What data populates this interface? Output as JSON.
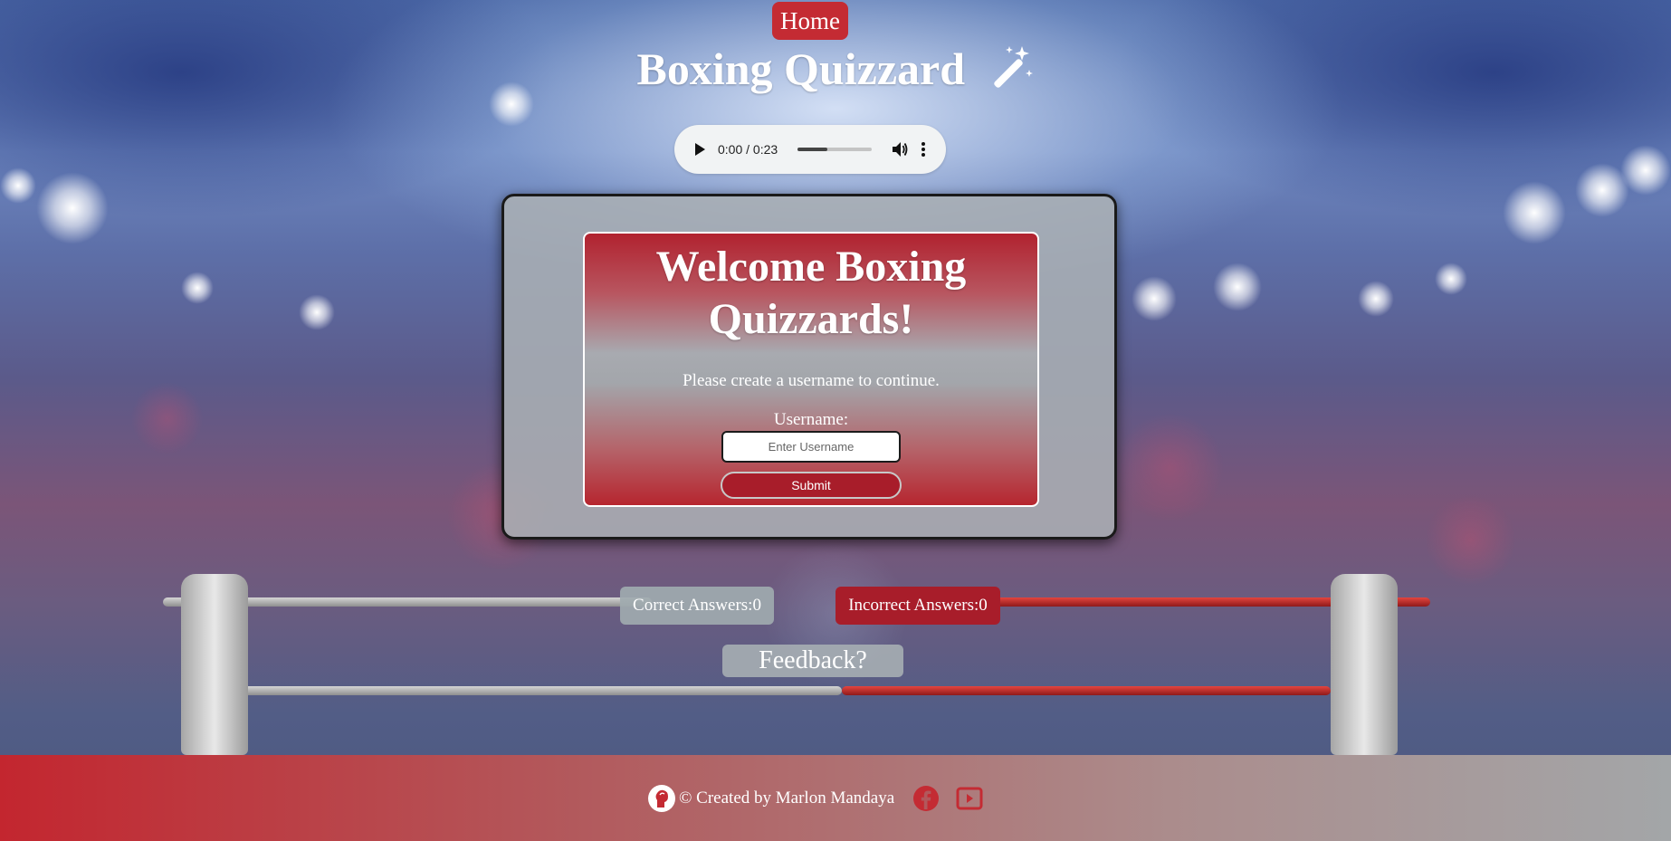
{
  "nav": {
    "home_label": "Home"
  },
  "header": {
    "title": "Boxing Quizzard",
    "title_icon": "magic-wand-icon"
  },
  "audio": {
    "time": "0:00 / 0:23",
    "progress_fraction": 0.4
  },
  "welcome": {
    "heading": "Welcome Boxing Quizzards!",
    "prompt": "Please create a username to continue.",
    "username_label": "Username:",
    "username_placeholder": "Enter Username",
    "username_value": "",
    "submit_label": "Submit"
  },
  "scores": {
    "correct_label": "Correct Answers:0",
    "incorrect_label": "Incorrect Answers:0"
  },
  "feedback": {
    "label": "Feedback?"
  },
  "footer": {
    "credit": "© Created by Marlon Mandaya",
    "social": [
      "facebook-icon",
      "youtube-icon"
    ]
  },
  "colors": {
    "accent_red": "#c42b33",
    "dark_red": "#a81d2a",
    "panel_grey": "#a9adb2"
  }
}
